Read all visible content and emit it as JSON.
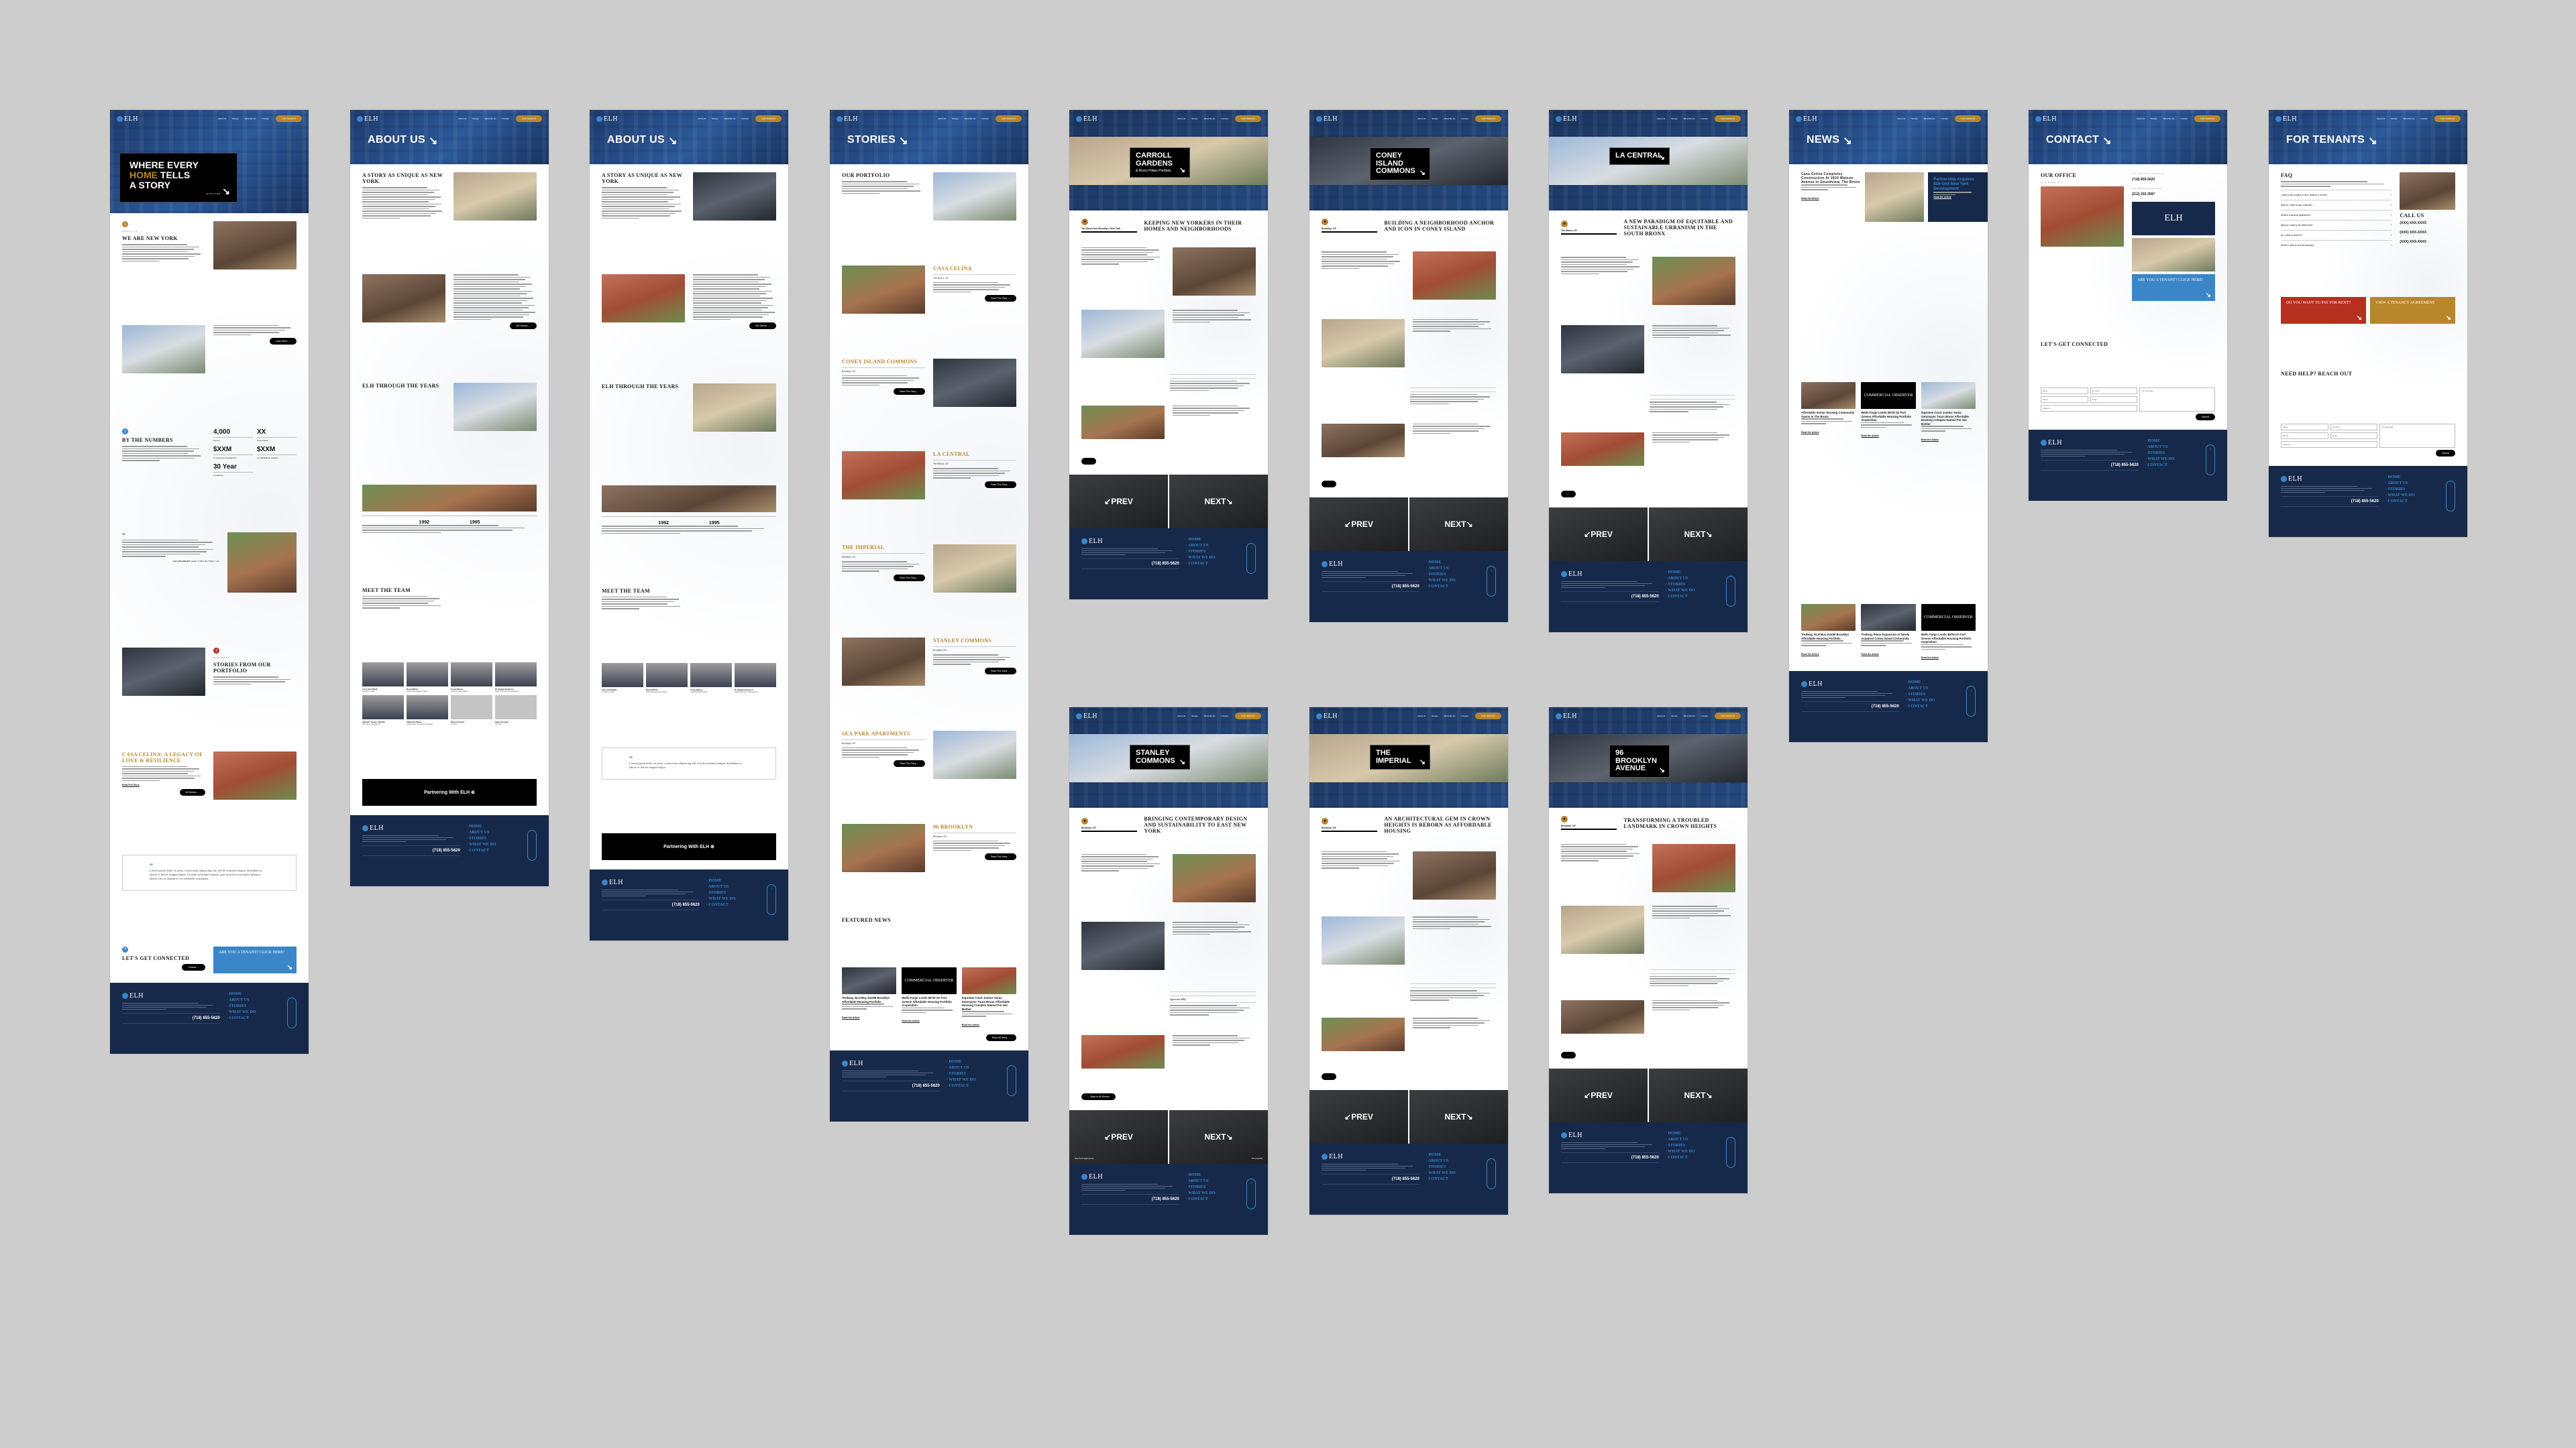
{
  "nav": {
    "logo": "ELH",
    "links": [
      "About Us",
      "Stories",
      "What We Do",
      "Contact"
    ],
    "tenants_button": "FOR TENANTS"
  },
  "footer": {
    "logo": "ELH",
    "phone": "(718) 855-5620",
    "links": [
      "HOME",
      "ABOUT US",
      "STORIES",
      "WHAT WE DO",
      "CONTACT"
    ]
  },
  "colors": {
    "navy": "#17294a",
    "header_blue": "#24477f",
    "gold": "#b8862b",
    "accent_blue": "#3a86c8",
    "red": "#b5301f"
  },
  "frames": [
    {
      "id": "home",
      "kind": "home",
      "hero": {
        "lines": [
          "WHERE EVERY",
          "HOME TELLS",
          "A STORY"
        ],
        "highlight": "HOME",
        "cta": "EXPLORE"
      },
      "blocks": [
        {
          "type": "split",
          "num": "1",
          "num_color": "#b8862b",
          "kicker": "ABOUT US",
          "heading": "WE ARE NEW YORK",
          "lines": 8
        },
        {
          "type": "split",
          "lines": 5,
          "button": "Learn More"
        },
        {
          "type": "split",
          "num": "2",
          "num_color": "#3a86c8",
          "heading": "BY THE NUMBERS",
          "lines": 7,
          "stats": [
            {
              "value": "4,000",
              "label": "homes"
            },
            {
              "value": "XX",
              "label": "communities"
            },
            {
              "value": "$XXM",
              "label": "in ground-up development"
            },
            {
              "value": "$XXM",
              "label": "in rehabilitation projects"
            },
            {
              "value": "30 Year",
              "label": "in business"
            }
          ]
        },
        {
          "type": "quote",
          "lines": 8,
          "author": "Larry Hirschfield",
          "role": "Founder & CEO, ELH Mgmt. LLC"
        },
        {
          "type": "split",
          "num": "3",
          "num_color": "#b5301f",
          "kicker": "OUR WORK",
          "heading": "STORIES FROM OUR PORTFOLIO",
          "lines": 4
        },
        {
          "type": "split",
          "heading": "CASA CELINA: A LEGACY OF LOVE & RESILIENCE",
          "gold": true,
          "lines": 7,
          "link": "Read Full Story",
          "button": "All Stories"
        },
        {
          "type": "testimonial",
          "text": "Lorem ipsum dolor sit amet, consectetur adipiscing elit, sed do eiusmod tempor incididunt ut labore et dolore magna aliqua. Ut enim ad minim veniam, quis nostrud exercitation ullamco laboris nisi ut aliquip ex ea commodo consequat."
        },
        {
          "type": "split",
          "num": "4",
          "num_color": "#3a86c8",
          "heading": "LET'S GET CONNECTED",
          "lines": 0,
          "button": "Contact",
          "cta": "ARE YOU A TENANT? CLICK HERE!"
        }
      ]
    },
    {
      "id": "about1",
      "kind": "banner",
      "title": "ABOUT US",
      "blocks": [
        {
          "type": "split",
          "heading": "A STORY AS UNIQUE AS NEW YORK",
          "lines": 14
        },
        {
          "type": "split",
          "lines": 20,
          "button": "Our Stories"
        },
        {
          "type": "split",
          "heading": "ELH THROUGH THE YEARS",
          "lines": 0
        },
        {
          "type": "timeline",
          "years": [
            "1992",
            "1995"
          ],
          "lines": 4
        },
        {
          "type": "split",
          "heading": "MEET THE TEAM",
          "lines": 6,
          "noimg": true
        },
        {
          "type": "team",
          "members": [
            {
              "name": "Larry Hirschfield",
              "role": "Founder & CEO"
            },
            {
              "name": "Rosie DiPoto",
              "role": "Chief Administrative Officer"
            },
            {
              "name": "Corey Barnes",
              "role": "Chief Financial Officer"
            },
            {
              "name": "Dr. Regina Anderson",
              "role": "Head of Property Management"
            },
            {
              "name": "Santokh \"Sonny\" Sandhu",
              "role": "Director of Construction"
            },
            {
              "name": "Catherine Rivera",
              "role": "Leasing and Compliance Manager"
            },
            {
              "name": "Name Surname",
              "role": "Job Title",
              "empty": true
            },
            {
              "name": "Name Surname",
              "role": "Job Title",
              "empty": true
            }
          ]
        },
        {
          "type": "banner",
          "label": "Partnering With ELH"
        }
      ]
    },
    {
      "id": "about2",
      "kind": "banner",
      "title": "ABOUT US",
      "blocks": [
        {
          "type": "split",
          "heading": "A STORY AS UNIQUE AS NEW YORK",
          "lines": 14
        },
        {
          "type": "split",
          "lines": 20,
          "button": "Our Stories"
        },
        {
          "type": "split",
          "heading": "ELH THROUGH THE YEARS",
          "lines": 0
        },
        {
          "type": "timeline",
          "years": [
            "1992",
            "1995"
          ],
          "lines": 4
        },
        {
          "type": "split",
          "heading": "MEET THE TEAM",
          "lines": 6,
          "noimg": true
        },
        {
          "type": "team",
          "members": [
            {
              "name": "Larry Hirschfield",
              "role": "Founder & CEO"
            },
            {
              "name": "Rosie DiPoto",
              "role": "Chief Administrative Officer"
            },
            {
              "name": "Corey Barnes",
              "role": "Chief Financial Officer"
            },
            {
              "name": "Dr. Regina Anderson",
              "role": "Head of Property Management"
            }
          ]
        },
        {
          "type": "testimonial",
          "text": "Lorem ipsum dolor sit amet, consectetur adipiscing elit, sed do eiusmod tempor incididunt ut labore et dolore magna aliqua."
        },
        {
          "type": "banner",
          "label": "Partnering With ELH"
        }
      ]
    },
    {
      "id": "stories",
      "kind": "banner",
      "title": "STORIES",
      "blocks": [
        {
          "type": "split",
          "heading": "OUR PORTFOLIO",
          "lines": 6
        },
        {
          "type": "split",
          "heading": "CASA CELINA",
          "gold": true,
          "location": "The Bronx, NY",
          "lines": 5,
          "button": "Read The Story"
        },
        {
          "type": "split",
          "heading": "CONEY ISLAND COMMONS",
          "gold": true,
          "location": "Brooklyn, NY",
          "lines": 5,
          "button": "Read The Story"
        },
        {
          "type": "split",
          "heading": "LA CENTRAL",
          "gold": true,
          "location": "The Bronx, NY",
          "lines": 5,
          "button": "Read The Story"
        },
        {
          "type": "split",
          "heading": "THE IMPERIAL",
          "gold": true,
          "location": "Brooklyn, NY",
          "lines": 5,
          "button": "Read The Story"
        },
        {
          "type": "split",
          "heading": "STANLEY COMMONS",
          "gold": true,
          "location": "Brooklyn, NY",
          "lines": 5,
          "button": "Read The Story"
        },
        {
          "type": "split",
          "heading": "SEA PARK APARTMENTS",
          "gold": true,
          "location": "Brooklyn, NY",
          "lines": 5,
          "button": "Read The Story"
        },
        {
          "type": "split",
          "heading": "96 BROOKLYN",
          "gold": true,
          "location": "Brooklyn, NY",
          "lines": 5,
          "button": "Read The Story"
        },
        {
          "type": "split",
          "heading": "FEATURED NEWS",
          "lines": 0,
          "noimg": true
        },
        {
          "type": "news",
          "items": [
            {
              "title": "Tredway, ELH Buy $110M Brooklyn Affordable Housing Portfolio"
            },
            {
              "title": "Wells Fargo Lends $97M On Fort Greene Affordable Housing Portfolio Acquisition",
              "logo": "COMMERCIAL OBSERVER"
            },
            {
              "title": "Supreme Court Justice Sonia Sotomayor Tours Bronx Affordable Housing Complex Named For Her Mother"
            }
          ],
          "link": "Read the Article",
          "button": "Read All News"
        }
      ]
    },
    {
      "id": "carroll",
      "kind": "project",
      "title": [
        "CARROLL",
        "GARDENS"
      ],
      "subtitle": "& Bronx Pillars Portfolio",
      "locale": {
        "location": "The Bronx and Brooklyn, New York",
        "heading": "KEEPING NEW YORKERS IN THEIR HOMES AND NEIGHBORHOODS"
      },
      "prev": {
        "label": "PREV",
        "caption": ""
      },
      "next": {
        "label": "NEXT",
        "caption": ""
      }
    },
    {
      "id": "coney",
      "kind": "project",
      "title": [
        "CONEY",
        "ISLAND",
        "COMMONS"
      ],
      "locale": {
        "location": "Brooklyn, NY",
        "heading": "BUILDING A NEIGHBORHOOD ANCHOR AND ICON IN CONEY ISLAND"
      },
      "prev": {
        "label": "PREV",
        "caption": ""
      },
      "next": {
        "label": "NEXT",
        "caption": ""
      }
    },
    {
      "id": "lacentral",
      "kind": "project",
      "title": [
        "LA CENTRAL"
      ],
      "locale": {
        "location": "The Bronx, NY",
        "heading": "A NEW PARADIGM OF EQUITABLE AND SUSTAINABLE URBANISM IN THE SOUTH BRONX"
      },
      "prev": {
        "label": "PREV",
        "caption": ""
      },
      "next": {
        "label": "NEXT",
        "caption": ""
      }
    },
    {
      "id": "news",
      "kind": "banner",
      "title": "NEWS",
      "blocks": [
        {
          "type": "featured",
          "items": [
            {
              "title": "Casa Celina Completes Construction At 1810 Watson Avenue In Soundview, The Bronx"
            },
            {
              "title": "Partnership Acquires 816-Unit New York Development"
            }
          ],
          "link": "Read the Article"
        },
        {
          "type": "news",
          "items": [
            {
              "title": "Affordable Senior Housing Community Opens In The Bronx"
            },
            {
              "title": "Wells Fargo Lends $97M On Fort Greene Affordable Housing Portfolio Acquisition",
              "logo": "COMMERCIAL OBSERVER"
            },
            {
              "title": "Supreme Court Justice Sonia Sotomayor Tours Bronx Affordable Housing Complex Named For Her Mother"
            }
          ],
          "link": "Read the Article"
        },
        {
          "type": "news",
          "items": [
            {
              "title": "Tredway, ELH Buy $110M Brooklyn Affordable Housing Portfolio"
            },
            {
              "title": "Tredway Plans Expansion At Newly Acquired Coney Island Community"
            },
            {
              "title": "Wells Fargo Lends $97M On Fort Greene Affordable Housing Portfolio Acquisition",
              "logo": "COMMERCIAL OBSERVER"
            }
          ],
          "link": "Read the Article"
        }
      ]
    },
    {
      "id": "contact",
      "kind": "banner",
      "title": "CONTACT",
      "blocks": [
        {
          "type": "office",
          "heading": "OUR OFFICE",
          "company": "ELH Mgmt. LLC",
          "contacts": [
            {
              "label": "For General Inquiries",
              "phone": "(718) 855-5620"
            },
            {
              "label": "For Media Inquiries",
              "phone": "(212) 203-3597"
            }
          ],
          "cta": "ARE YOU A TENANT? CLICK HERE!"
        },
        {
          "type": "split",
          "heading": "LET'S GET CONNECTED",
          "lines": 0,
          "noimg": true
        },
        {
          "type": "form",
          "fields": [
            "Name",
            "Surname",
            "Phone",
            "Email",
            "Subject"
          ],
          "message": "Your Message ...",
          "submit": "Submit"
        }
      ]
    },
    {
      "id": "tenants",
      "kind": "banner",
      "title": "FOR TENANTS",
      "blocks": [
        {
          "type": "faq",
          "heading": "FAQ",
          "questions": [
            "I need to find a place to rent. What do I do first?",
            "Why do I have to pay a deposit?",
            "What is a tenancy agreement?",
            "Why do I need to be referenced?",
            "Do I need to show ID?",
            "What if I want to end the tenancy?"
          ],
          "call_heading": "CALL US",
          "phones": [
            "(XXX) XXX-XXXX",
            "(XXX) XXX-XXXX",
            "(XXX) XXX-XXXX"
          ]
        },
        {
          "type": "ctas",
          "items": [
            {
              "label": "DO YOU WANT TO PAY FOR RENT?",
              "color": "#b5301f"
            },
            {
              "label": "VIEW A TENANCY AGREEMENT",
              "color": "#b8862b"
            }
          ]
        },
        {
          "type": "split",
          "heading": "NEED HELP? REACH OUT",
          "lines": 0,
          "noimg": true
        },
        {
          "type": "form",
          "fields": [
            "Name",
            "Surname",
            "Phone",
            "Email",
            "Subject"
          ],
          "message": "Your Message",
          "submit": "Submit"
        }
      ]
    },
    {
      "id": "stanley",
      "kind": "project",
      "title": [
        "STANLEY",
        "COMMONS"
      ],
      "locale": {
        "location": "Brooklyn, NY",
        "heading": "BRINGING CONTEMPORARY DESIGN AND SUSTAINABILITY TO EAST NEW YORK"
      },
      "agencies_label": "Agencies:",
      "agency_logo": "NYC",
      "back_button": "Back to All Stories",
      "prev": {
        "label": "PREV",
        "caption": "Sea Park Apartments"
      },
      "next": {
        "label": "NEXT",
        "caption": "The Imperial"
      }
    },
    {
      "id": "imperial",
      "kind": "project",
      "title": [
        "THE",
        "IMPERIAL"
      ],
      "locale": {
        "location": "Brooklyn, NY",
        "heading": "AN ARCHITECTURAL GEM IN CROWN HEIGHTS IS REBORN AS AFFORDABLE HOUSING"
      },
      "prev": {
        "label": "PREV",
        "caption": ""
      },
      "next": {
        "label": "NEXT",
        "caption": ""
      }
    },
    {
      "id": "brooklyn",
      "kind": "project",
      "title": [
        "96",
        "BROOKLYN",
        "AVENUE"
      ],
      "locale": {
        "location": "Brooklyn, NY",
        "heading": "TRANSFORMING A TROUBLED LANDMARK IN CROWN HEIGHTS"
      },
      "prev": {
        "label": "PREV",
        "caption": ""
      },
      "next": {
        "label": "NEXT",
        "caption": ""
      }
    }
  ]
}
